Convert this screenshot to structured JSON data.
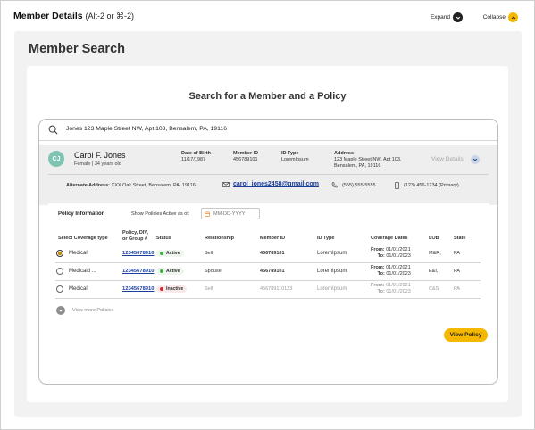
{
  "header": {
    "title": "Member Details",
    "shortcut_hint": "(Alt-2 or ⌘-2)",
    "expand_label": "Expand",
    "collapse_label": "Collapse"
  },
  "page": {
    "title": "Member Search",
    "search_heading": "Search for a Member and a Policy"
  },
  "search": {
    "value": "Jones  123 Maple Street NW, Apt 103, Bensalem, PA, 19116"
  },
  "member": {
    "initials": "CJ",
    "name": "Carol F. Jones",
    "subtitle": "Female | 34 years old",
    "dob_label": "Date of Birth",
    "dob": "11/17/1987",
    "member_id_label": "Member ID",
    "member_id": "456789101",
    "id_type_label": "ID Type",
    "id_type": "LoremIpsum",
    "address_label": "Address",
    "address_line1": "123 Maple Street NW, Apt 103,",
    "address_line2": "Bensalem, PA, 19116",
    "view_details": "View Details",
    "alt_address_label": "Alternate Address:",
    "alt_address": "XXX Oak Street, Bensalem, PA, 19116",
    "email": "carol_jones2458@gmail.com",
    "phone": "(555) 555-5555",
    "mobile": "(123) 456-1234  (Primary)"
  },
  "policy": {
    "section_label": "Policy Information",
    "show_active_label": "Show Policies Active as of:",
    "date_placeholder": "MM-DD-YYYY",
    "columns": {
      "select": "Select Coverage type",
      "policy_line1": "Policy, DIV,",
      "policy_line2": "or Group #",
      "status": "Status",
      "relationship": "Relationship",
      "member_id": "Member ID",
      "id_type": "ID Type",
      "coverage_dates": "Coverage Dates",
      "lob": "LOB",
      "state": "State"
    },
    "from_label": "From:",
    "to_label": "To:",
    "rows": [
      {
        "coverage": "Medical",
        "policy": "12345678910",
        "status": "Active",
        "relationship": "Self",
        "member_id": "456789101",
        "id_type": "LoremIpsum",
        "from": "01/01/2021",
        "to": "01/01/2023",
        "lob": "M&R,",
        "state": "PA"
      },
      {
        "coverage": "Medicaid ...",
        "policy": "12345678910",
        "status": "Active",
        "relationship": "Spouse",
        "member_id": "456789101",
        "id_type": "LoremIpsum",
        "from": "01/01/2021",
        "to": "01/01/2023",
        "lob": "E&I,",
        "state": "PA"
      },
      {
        "coverage": "Medical",
        "policy": "12345678910",
        "status": "Inactive",
        "relationship": "Self",
        "member_id": "456789110123",
        "id_type": "LoremIpsum",
        "from": "01/01/2021",
        "to": "01/01/2023",
        "lob": "C&S",
        "state": "PA"
      }
    ],
    "view_more": "View more Policies"
  },
  "actions": {
    "view_policy": "View Policy"
  },
  "colors": {
    "accent_yellow": "#f5b800",
    "link_blue": "#1a3e9b",
    "avatar_teal": "#7fc4b2",
    "active_green": "#3bb43b",
    "inactive_red": "#d02a2a"
  }
}
